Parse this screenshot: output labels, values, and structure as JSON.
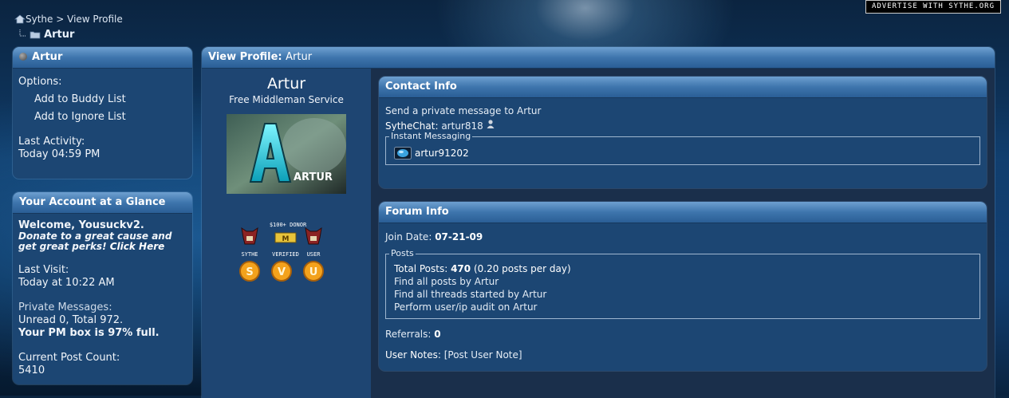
{
  "advertise": "ADVERTISE WITH SYTHE.ORG",
  "breadcrumb": {
    "site": "Sythe",
    "sep": ">",
    "page": "View Profile",
    "current": "Artur"
  },
  "user_panel": {
    "title": "Artur",
    "options_label": "Options:",
    "add_buddy": "Add to Buddy List",
    "add_ignore": "Add to Ignore List",
    "last_activity_label": "Last Activity:",
    "last_activity_value": "Today 04:59 PM"
  },
  "glance": {
    "title": "Your Account at a Glance",
    "welcome": "Welcome, Yousuckv2.",
    "donate": "Donate to a great cause and get great perks!",
    "donate_link": "Click Here",
    "last_visit_label": "Last Visit:",
    "last_visit_value": "Today at 10:22 AM",
    "pm_label": "Private Messages:",
    "pm_counts": "Unread 0, Total 972.",
    "pm_full": "Your PM box is 97% full.",
    "post_count_label": "Current Post Count:",
    "post_count_value": "5410"
  },
  "profile": {
    "header_label": "View Profile",
    "header_name": "Artur",
    "username": "Artur",
    "user_title": "Free Middleman Service",
    "avatar_text": "ARTUR",
    "badge_caption": "$100+ DONOR",
    "badges": [
      "SYTHE",
      "VERIFIED",
      "USER"
    ]
  },
  "contact": {
    "title": "Contact Info",
    "pm_link": "Send a private message to Artur",
    "sythechat_label": "SytheChat:",
    "sythechat_value": "artur818",
    "im_legend": "Instant Messaging",
    "im_handle": "artur91202"
  },
  "forum": {
    "title": "Forum Info",
    "join_label": "Join Date:",
    "join_value": "07-21-09",
    "posts_legend": "Posts",
    "total_label": "Total Posts:",
    "total_value": "470",
    "per_day": "(0.20 posts per day)",
    "find_posts": "Find all posts by Artur",
    "find_threads": "Find all threads started by Artur",
    "audit": "Perform user/ip audit on Artur",
    "referrals_label": "Referrals:",
    "referrals_value": "0",
    "notes_label": "User Notes:",
    "notes_link": "[Post User Note]"
  }
}
